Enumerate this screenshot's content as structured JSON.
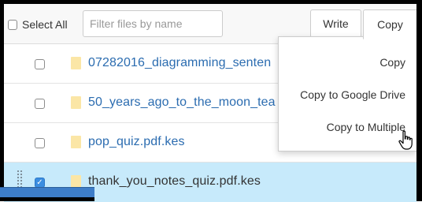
{
  "toolbar": {
    "select_all_label": "Select All",
    "filter_placeholder": "Filter files by name",
    "write_label": "Write",
    "copy_label": "Copy"
  },
  "copy_menu": {
    "items": [
      {
        "label": "Copy"
      },
      {
        "label": "Copy to Google Drive"
      },
      {
        "label": "Copy to Multiple"
      }
    ]
  },
  "files": [
    {
      "name": "07282016_diagramming_senten",
      "checked": false
    },
    {
      "name": "50_years_ago_to_the_moon_tea",
      "checked": false
    },
    {
      "name": "pop_quiz.pdf.kes",
      "checked": false
    },
    {
      "name": "thank_you_notes_quiz.pdf.kes",
      "checked": true
    }
  ],
  "colors": {
    "link": "#2b6cb0",
    "selected_row": "#c7eafb",
    "checkbox_checked": "#3b8de0",
    "file_icon": "#fbe6a6"
  },
  "icons": {
    "file": "file-icon",
    "cursor": "hand-pointer-icon",
    "drag": "drag-handle-icon"
  }
}
